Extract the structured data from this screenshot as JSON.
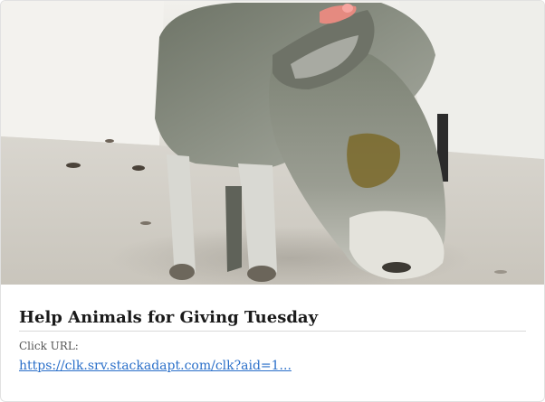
{
  "ad": {
    "title": "Help Animals for Giving Tuesday",
    "url_label": "Click URL:",
    "url_text": "https://clk.srv.stackadapt.com/clk?aid=1...",
    "image_icon": "donkey-photo"
  },
  "colors": {
    "title": "#1a1a1a",
    "link": "#2a6fc9",
    "label": "#555555",
    "border": "#e1e1e1",
    "wall": "#ecebe6",
    "floor": "#d8d4cc",
    "fur": "#7d8477"
  }
}
